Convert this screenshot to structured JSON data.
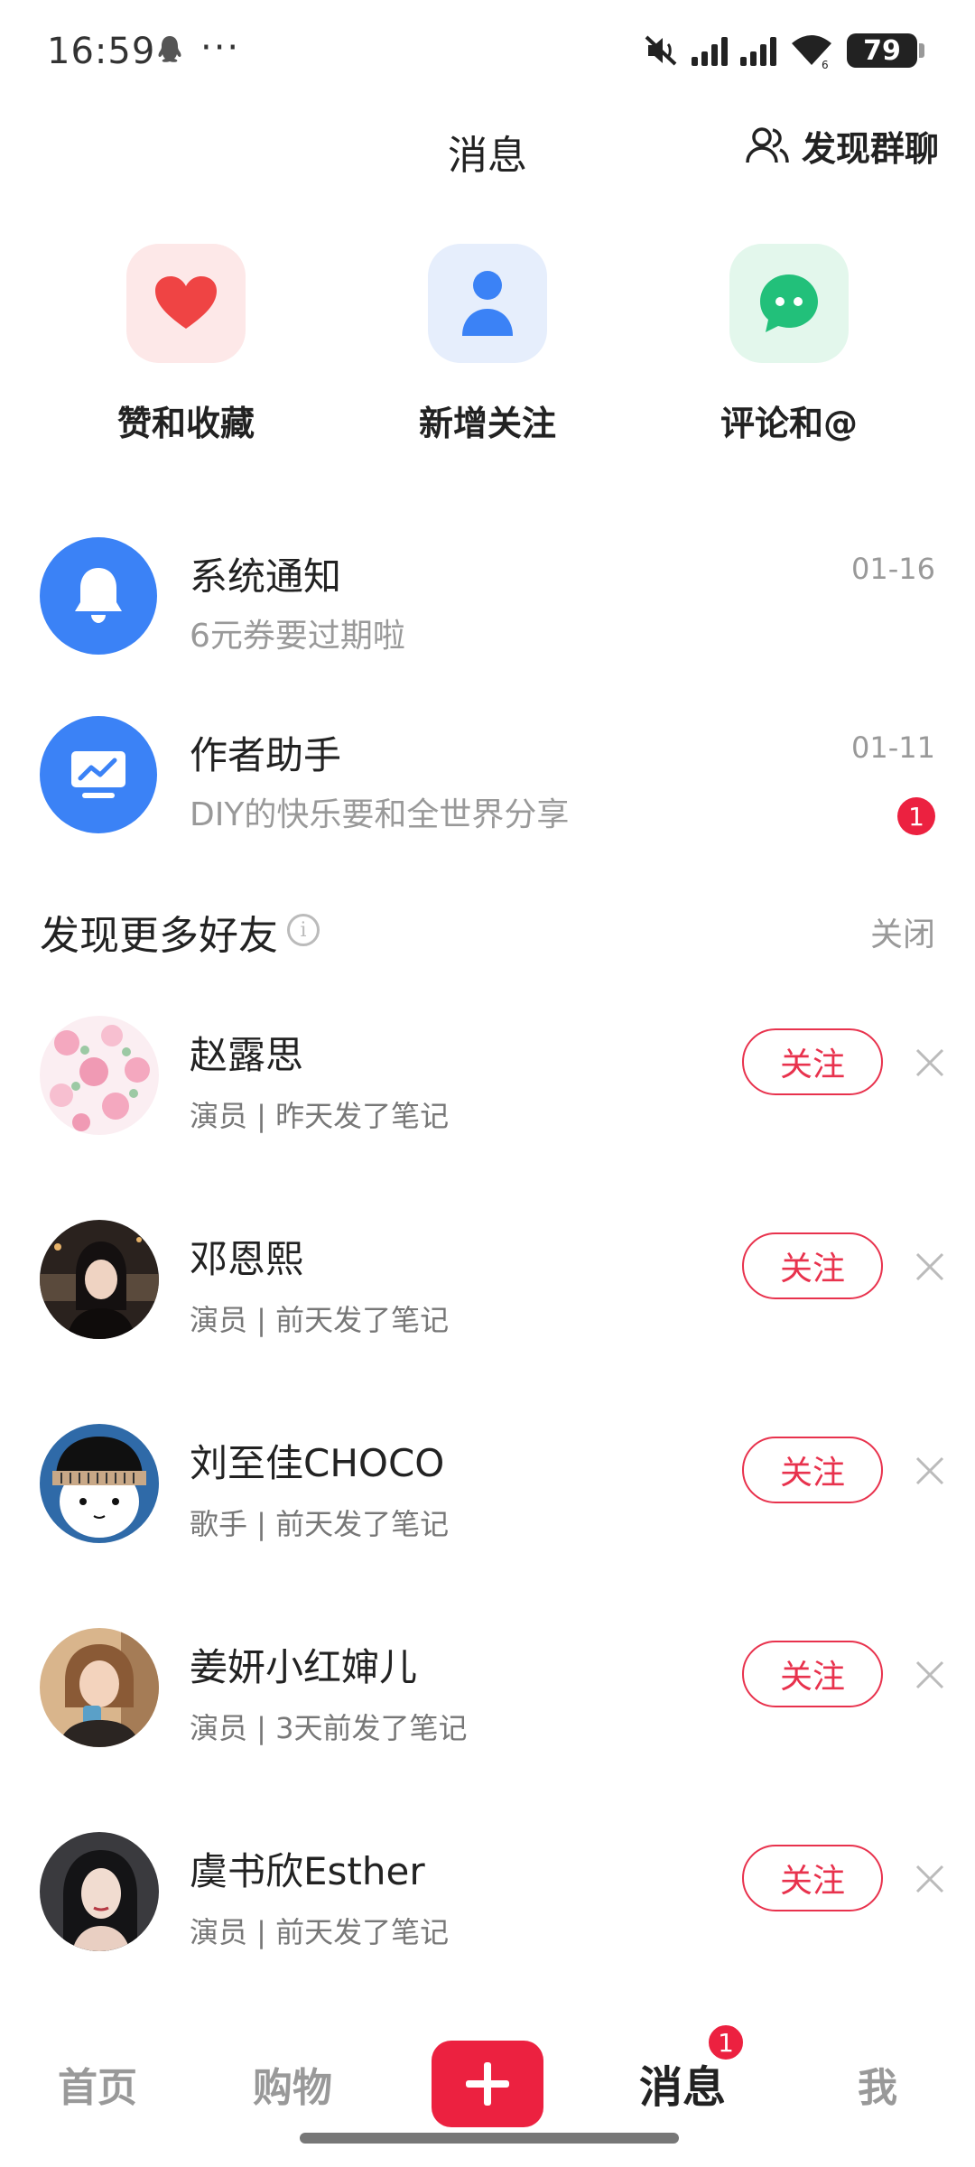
{
  "status_bar": {
    "time": "16:59",
    "more": "···",
    "wifi_sub": "6",
    "battery": "79",
    "icons": [
      "qq-icon",
      "mute-icon",
      "signal-icon",
      "signal-icon",
      "wifi-icon",
      "battery-icon"
    ]
  },
  "header": {
    "title": "消息",
    "discover_group": "发现群聊"
  },
  "quick_actions": [
    {
      "label": "赞和收藏",
      "icon": "heart-icon",
      "color": "#ef4444",
      "bg": "#fde8e8"
    },
    {
      "label": "新增关注",
      "icon": "person-icon",
      "color": "#3b82f6",
      "bg": "#e6eefc"
    },
    {
      "label": "评论和@",
      "icon": "chat-icon",
      "color": "#22c07a",
      "bg": "#e3f7ec"
    }
  ],
  "messages": [
    {
      "title": "系统通知",
      "subtitle": "6元券要过期啦",
      "time": "01-16",
      "icon": "bell-icon"
    },
    {
      "title": "作者助手",
      "subtitle": "DIY的快乐要和全世界分享",
      "time": "01-11",
      "badge": "1",
      "icon": "chart-monitor-icon"
    }
  ],
  "discover": {
    "title": "发现更多好友",
    "info_icon": "i",
    "close": "关闭",
    "friends": [
      {
        "name": "赵露思",
        "desc": "演员 | 昨天发了笔记",
        "follow": "关注"
      },
      {
        "name": "邓恩熙",
        "desc": "演员 | 前天发了笔记",
        "follow": "关注"
      },
      {
        "name": "刘至佳CHOCO",
        "desc": "歌手 | 前天发了笔记",
        "follow": "关注"
      },
      {
        "name": "姜妍小红婶儿",
        "desc": "演员 | 3天前发了笔记",
        "follow": "关注"
      },
      {
        "name": "虞书欣Esther",
        "desc": "演员 | 前天发了笔记",
        "follow": "关注"
      }
    ]
  },
  "bottom_nav": {
    "home": "首页",
    "shop": "购物",
    "messages": "消息",
    "messages_badge": "1",
    "me": "我",
    "active": "messages"
  },
  "colors": {
    "accent": "#ec2140",
    "blue": "#3b82f6"
  }
}
